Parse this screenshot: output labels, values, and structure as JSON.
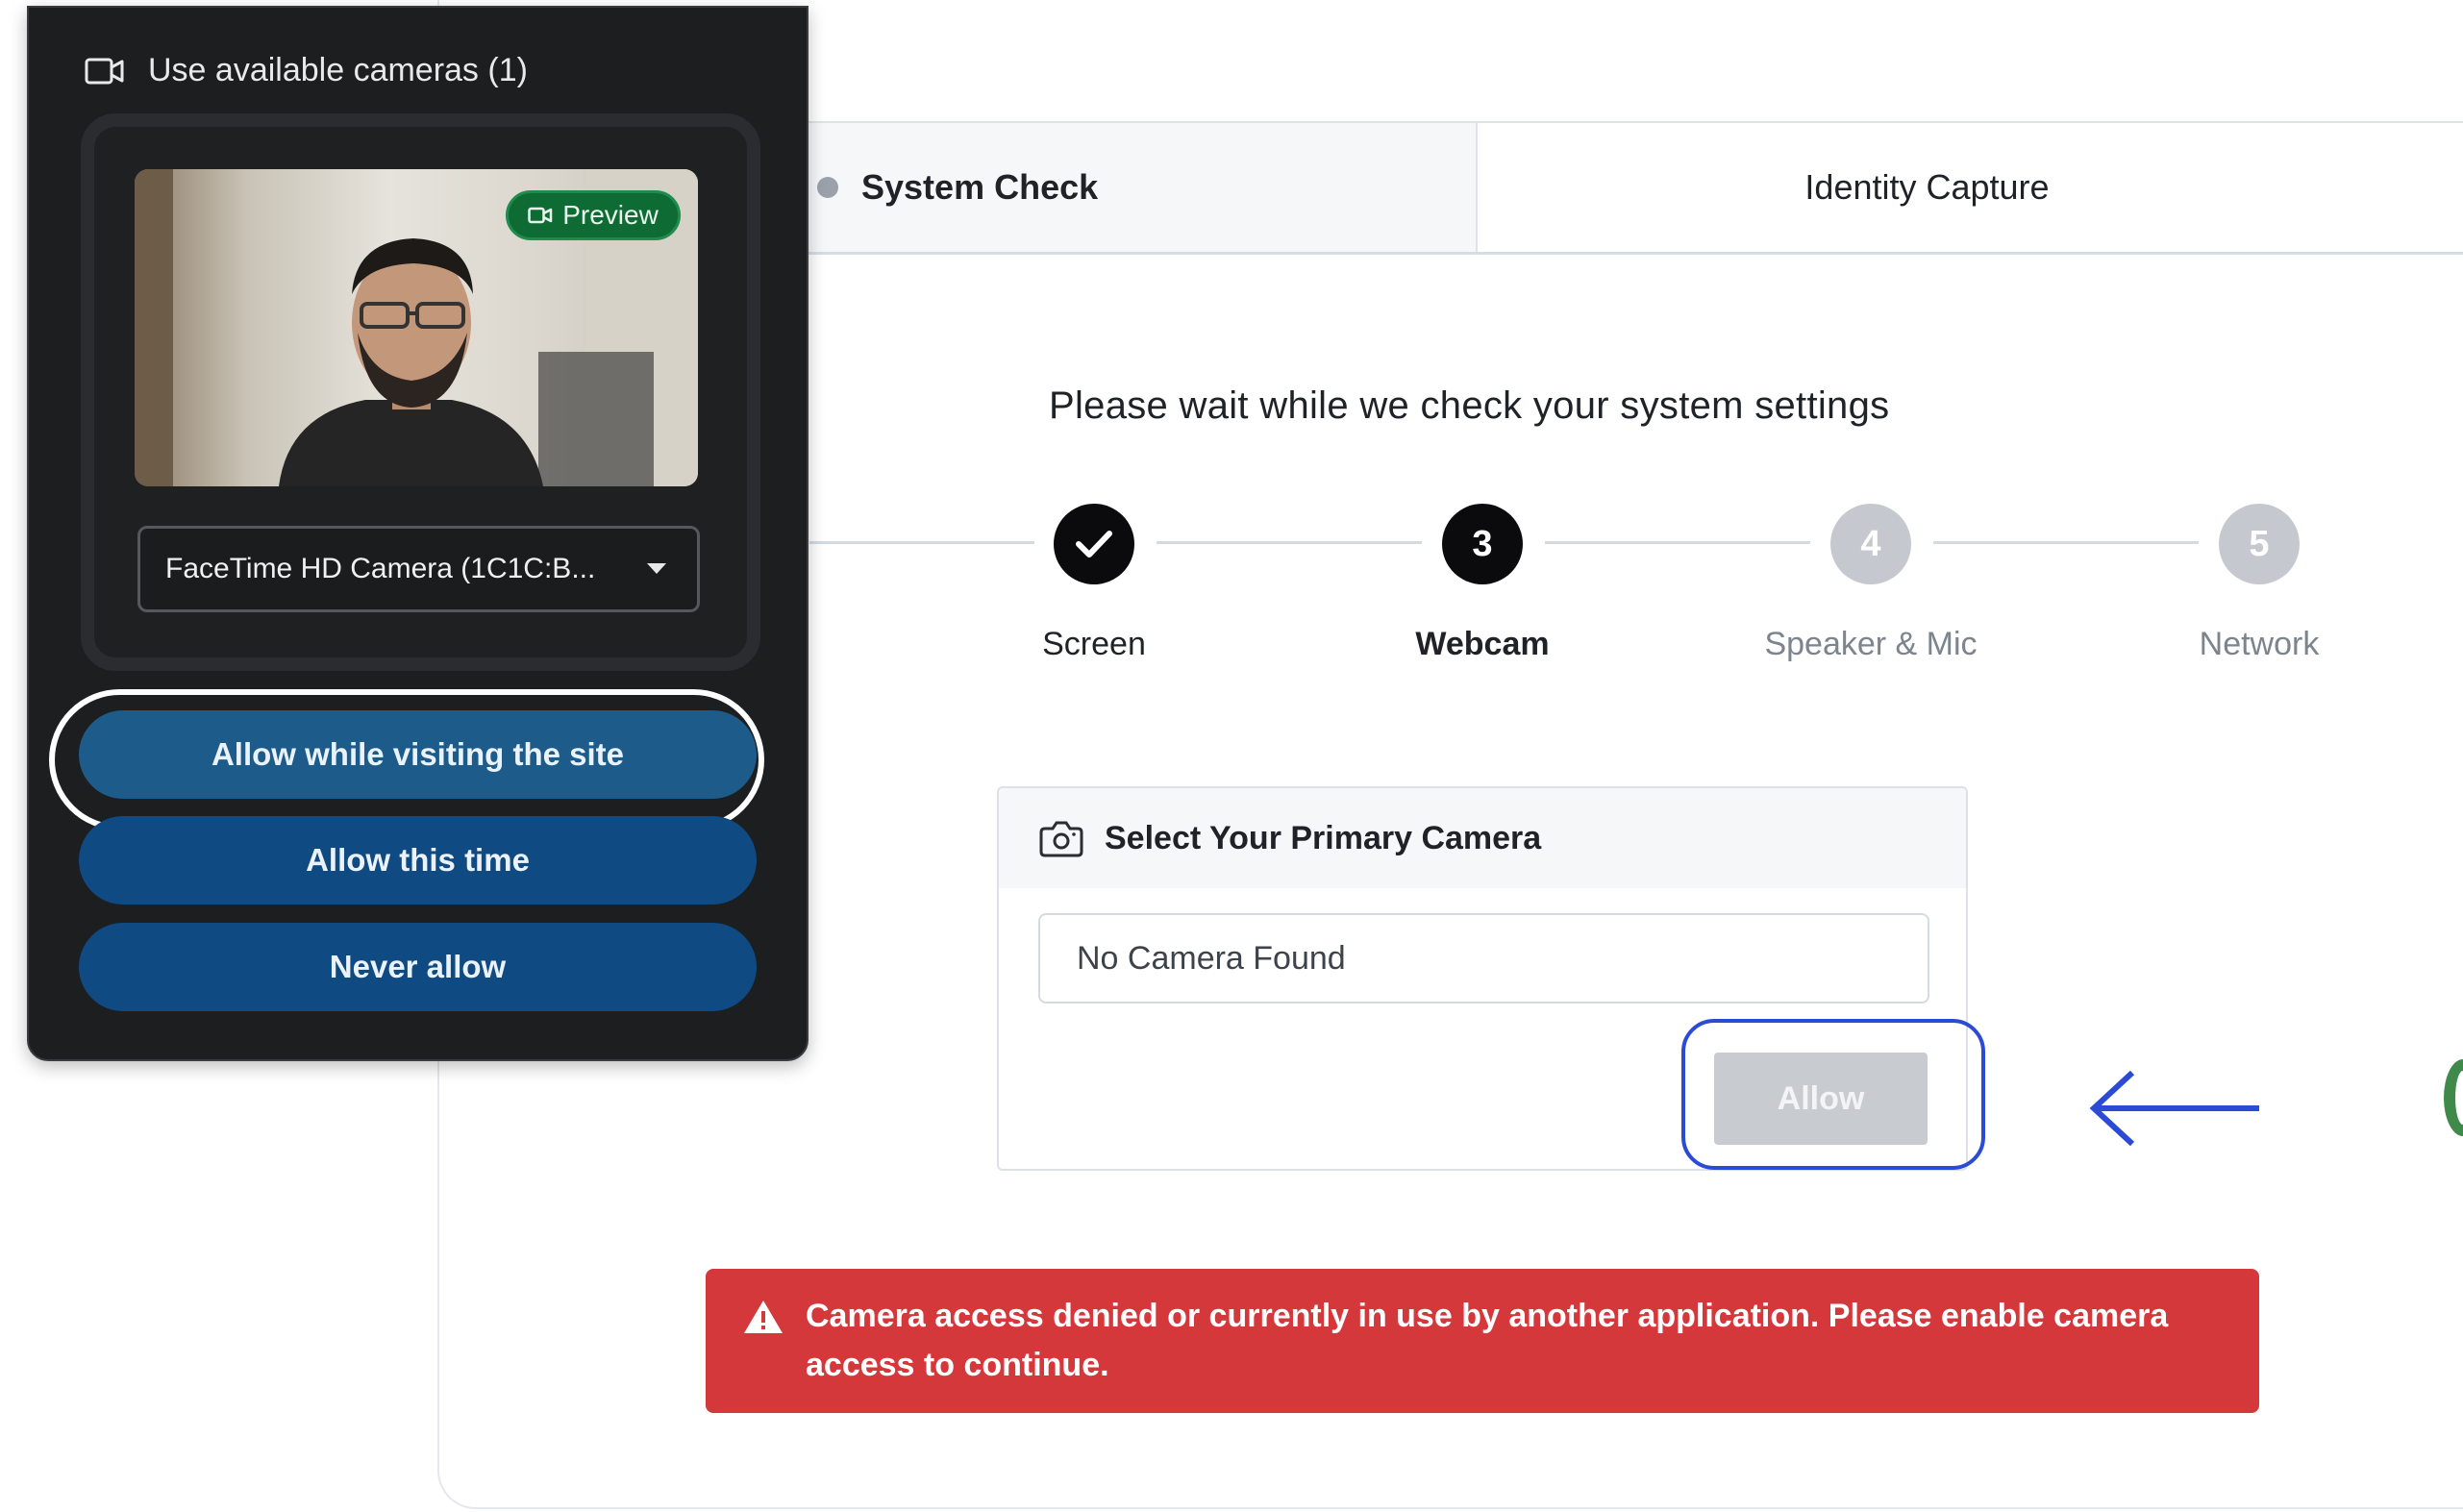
{
  "tabs": {
    "system_check": "System Check",
    "identity_capture": "Identity Capture"
  },
  "headline": "Please wait while we check your system settings",
  "stepper": {
    "steps": [
      {
        "label": "Screen",
        "number": "",
        "state": "done"
      },
      {
        "label": "Webcam",
        "number": "3",
        "state": "active"
      },
      {
        "label": "Speaker & Mic",
        "number": "4",
        "state": "pending"
      },
      {
        "label": "Network",
        "number": "5",
        "state": "pending"
      }
    ]
  },
  "camera_panel": {
    "title": "Select Your Primary Camera",
    "input_value": "No Camera Found",
    "allow_label": "Allow"
  },
  "error": {
    "message": "Camera access denied or currently in use by another application. Please enable camera access to continue."
  },
  "popup": {
    "title": "Use available cameras (1)",
    "preview_badge": "Preview",
    "camera_select": "FaceTime HD Camera (1C1C:B...",
    "buttons": {
      "allow_while_visiting": "Allow while visiting the site",
      "allow_this_time": "Allow this time",
      "never_allow": "Never allow"
    }
  },
  "colors": {
    "error_red": "#d5383a",
    "popup_bg": "#1d1e20",
    "permission_button_blue": "#0f4a82",
    "highlight_ring_blue": "#2b4ad6",
    "preview_badge_green": "#0f6b34"
  }
}
